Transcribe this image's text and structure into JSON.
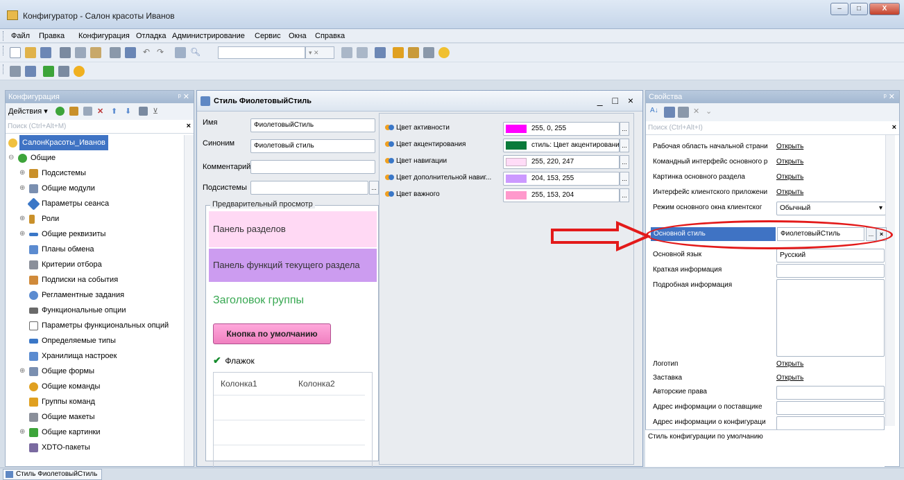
{
  "window": {
    "title": "Конфигуратор - Салон красоты Иванов",
    "buttons": [
      "–",
      "□",
      "X"
    ]
  },
  "menu": [
    "Файл",
    "Правка",
    "Конфигурация",
    "Отладка",
    "Администрирование",
    "Сервис",
    "Окна",
    "Справка"
  ],
  "config_panel": {
    "title": "Конфигурация",
    "actions_label": "Действия ▾",
    "search_placeholder": "Поиск (Ctrl+Alt+M)",
    "tree": [
      {
        "label": "СалонКрасоты_Иванов",
        "icon": "config-root-icon",
        "color": "#f0c040"
      },
      {
        "label": "Общие",
        "icon": "common-icon",
        "color": "#3da43a"
      },
      {
        "label": "Подсистемы",
        "icon": "subsystems-icon",
        "color": "#c9902a"
      },
      {
        "label": "Общие модули",
        "icon": "modules-icon",
        "color": "#7a8fb0"
      },
      {
        "label": "Параметры сеанса",
        "icon": "session-params-icon",
        "color": "#3a77c7"
      },
      {
        "label": "Роли",
        "icon": "roles-icon",
        "color": "#c9902a"
      },
      {
        "label": "Общие реквизиты",
        "icon": "attributes-icon",
        "color": "#3a77c7"
      },
      {
        "label": "Планы обмена",
        "icon": "exchange-plans-icon",
        "color": "#5b8bd0"
      },
      {
        "label": "Критерии отбора",
        "icon": "filter-criteria-icon",
        "color": "#8a8f9a"
      },
      {
        "label": "Подписки на события",
        "icon": "subscriptions-icon",
        "color": "#d08a3a"
      },
      {
        "label": "Регламентные задания",
        "icon": "scheduled-jobs-icon",
        "color": "#5b8bd0"
      },
      {
        "label": "Функциональные опции",
        "icon": "functional-options-icon",
        "color": "#6a6a6a"
      },
      {
        "label": "Параметры функциональных опций",
        "icon": "fo-params-icon",
        "color": "#6a6a6a"
      },
      {
        "label": "Определяемые типы",
        "icon": "defined-types-icon",
        "color": "#3a77c7"
      },
      {
        "label": "Хранилища настроек",
        "icon": "settings-storage-icon",
        "color": "#5b8bd0"
      },
      {
        "label": "Общие формы",
        "icon": "forms-icon",
        "color": "#7a8fb0"
      },
      {
        "label": "Общие команды",
        "icon": "commands-icon",
        "color": "#e0a020"
      },
      {
        "label": "Группы команд",
        "icon": "command-groups-icon",
        "color": "#e0a020"
      },
      {
        "label": "Общие макеты",
        "icon": "templates-icon",
        "color": "#8a8f9a"
      },
      {
        "label": "Общие картинки",
        "icon": "pictures-icon",
        "color": "#3da43a"
      },
      {
        "label": "XDTO-пакеты",
        "icon": "xdto-icon",
        "color": "#7a6aa0"
      }
    ]
  },
  "style_window": {
    "title": "Стиль ФиолетовыйСтиль",
    "controls": "_ □ ×",
    "fields": {
      "name_label": "Имя",
      "name_value": "ФиолетовыйСтиль",
      "synonym_label": "Синоним",
      "synonym_value": "Фиолетовый стиль",
      "comment_label": "Комментарий",
      "comment_value": "",
      "subsystems_label": "Подсистемы",
      "subsystems_value": ""
    },
    "preview": {
      "legend": "Предварительный просмотр",
      "sections_panel": "Панель разделов",
      "functions_panel": "Панель функций текущего раздела",
      "group_header": "Заголовок группы",
      "default_button": "Кнопка по умолчанию",
      "checkbox": "Флажок",
      "col1": "Колонка1",
      "col2": "Колонка2"
    },
    "colors": [
      {
        "label": "Цвет активности",
        "value": "255, 0, 255",
        "swatch": "#ff00ff"
      },
      {
        "label": "Цвет акцентирования",
        "value": "стиль: Цвет акцентирования",
        "swatch": "#0a7a3a"
      },
      {
        "label": "Цвет навигации",
        "value": "255, 220, 247",
        "swatch": "#ffdcf7"
      },
      {
        "label": "Цвет дополнительной навиг...",
        "value": "204, 153, 255",
        "swatch": "#cc99ff"
      },
      {
        "label": "Цвет важного",
        "value": "255, 153, 204",
        "swatch": "#ff99cc"
      }
    ]
  },
  "properties": {
    "title": "Свойства",
    "search_placeholder": "Поиск (Ctrl+Alt+I)",
    "rows": [
      {
        "name": "Рабочая область начальной страни",
        "value": "Открыть"
      },
      {
        "name": "Командный интерфейс основного р",
        "value": "Открыть"
      },
      {
        "name": "Картинка основного раздела",
        "value": "Открыть"
      },
      {
        "name": "Интерфейс клиентского приложени",
        "value": "Открыть"
      }
    ],
    "main_window_mode_label": "Режим основного окна клиентског",
    "main_window_mode_value": "Обычный",
    "main_style_label": "Основной стиль",
    "main_style_value": "ФиолетовыйСтиль",
    "main_language_label": "Основной язык",
    "main_language_value": "Русский",
    "brief_info_label": "Краткая информация",
    "detailed_info_label": "Подробная информация",
    "logo_label": "Логотип",
    "logo_value": "Открыть",
    "splash_label": "Заставка",
    "splash_value": "Открыть",
    "copyright_label": "Авторские права",
    "vendor_address_label": "Адрес информации о поставщике",
    "config_address_label": "Адрес информации о конфигураци",
    "description": "Стиль конфигурации по умолчанию"
  },
  "statusbar": {
    "tab_label": "Стиль ФиолетовыйСтиль"
  },
  "colors": {
    "highlight": "#3f73c4",
    "annotation_red": "#e31a1a"
  }
}
